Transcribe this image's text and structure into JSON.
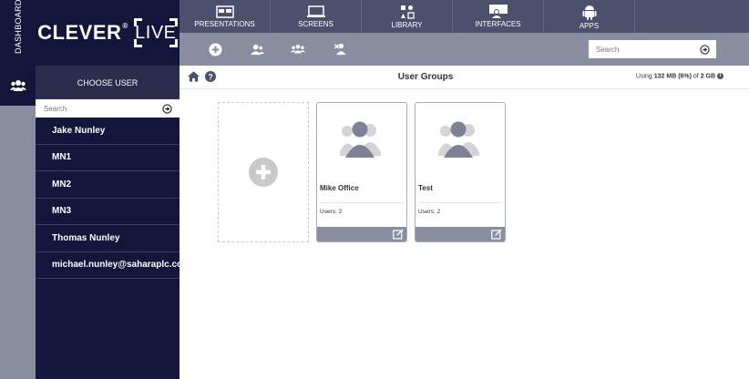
{
  "rail": {
    "dashboard_label": "DASHBOARD"
  },
  "brand": {
    "name": "CLEVER",
    "reg": "®",
    "live": "LIVE"
  },
  "nav": {
    "items": [
      {
        "label": "PRESENTATIONS",
        "icon": "presentations-icon"
      },
      {
        "label": "SCREENS",
        "icon": "screens-icon"
      },
      {
        "label": "LIBRARY",
        "icon": "library-icon"
      },
      {
        "label": "INTERFACES",
        "icon": "interfaces-icon"
      },
      {
        "label": "APPS",
        "icon": "android-icon"
      }
    ],
    "search_placeholder": "Search"
  },
  "sidebar": {
    "title": "CHOOSE USER",
    "search_placeholder": "Search",
    "users": [
      "Jake Nunley",
      "MN1",
      "MN2",
      "MN3",
      "Thomas Nunley",
      "michael.nunley@saharaplc.com"
    ]
  },
  "main": {
    "title": "User Groups",
    "usage_prefix": "Using ",
    "usage_used": "132 MB (6%)",
    "usage_mid": " of ",
    "usage_total": "2 GB",
    "groups": [
      {
        "name": "Mike Office",
        "users": "Users: 2"
      },
      {
        "name": "Test",
        "users": "Users: 2"
      }
    ]
  },
  "colors": {
    "navy": "#13163a",
    "nav": "#4d506c",
    "subnav": "#8a8da0"
  }
}
